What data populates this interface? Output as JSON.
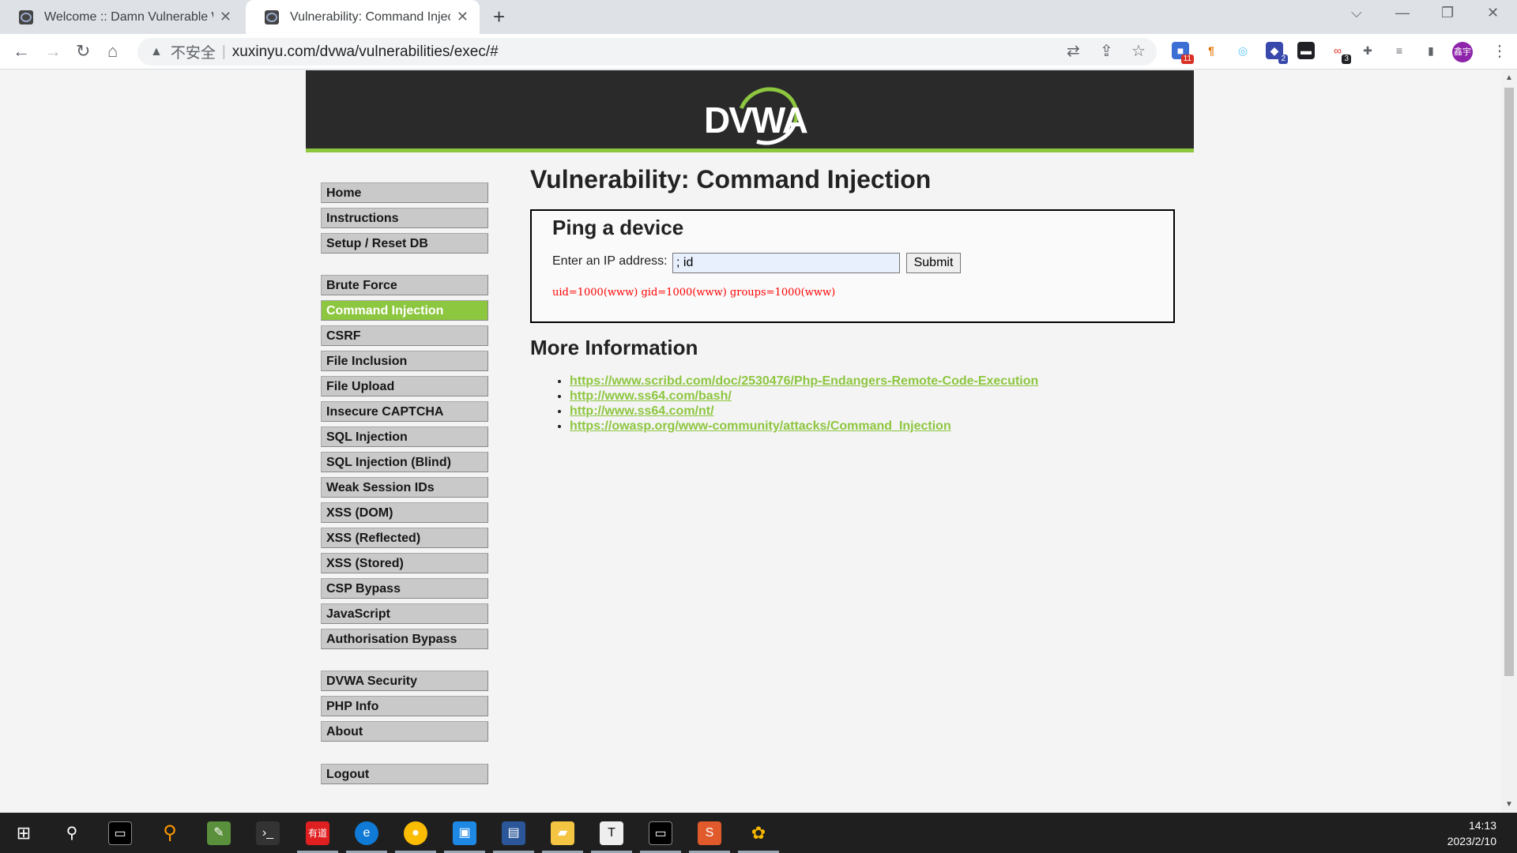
{
  "browser": {
    "tabs": [
      {
        "title": "Welcome :: Damn Vulnerable Web",
        "active": false
      },
      {
        "title": "Vulnerability: Command Inject",
        "active": true
      }
    ],
    "security_label": "不安全",
    "url": "xuxinyu.com/dvwa/vulnerabilities/exec/#",
    "profile_initials": "鑫宇",
    "extension_badges": [
      "11",
      "2",
      "3"
    ]
  },
  "page": {
    "logo_text": "DVWA",
    "menu": {
      "group1": [
        "Home",
        "Instructions",
        "Setup / Reset DB"
      ],
      "group2": [
        "Brute Force",
        "Command Injection",
        "CSRF",
        "File Inclusion",
        "File Upload",
        "Insecure CAPTCHA",
        "SQL Injection",
        "SQL Injection (Blind)",
        "Weak Session IDs",
        "XSS (DOM)",
        "XSS (Reflected)",
        "XSS (Stored)",
        "CSP Bypass",
        "JavaScript",
        "Authorisation Bypass"
      ],
      "group3": [
        "DVWA Security",
        "PHP Info",
        "About"
      ],
      "group4": [
        "Logout"
      ],
      "selected": "Command Injection"
    },
    "title": "Vulnerability: Command Injection",
    "form": {
      "heading": "Ping a device",
      "ip_label": "Enter an IP address:",
      "ip_value": "; id",
      "submit_label": "Submit",
      "output": "uid=1000(www) gid=1000(www) groups=1000(www)"
    },
    "more_info": {
      "heading": "More Information",
      "links": [
        "https://www.scribd.com/doc/2530476/Php-Endangers-Remote-Code-Execution",
        "http://www.ss64.com/bash/",
        "http://www.ss64.com/nt/",
        "https://owasp.org/www-community/attacks/Command_Injection"
      ]
    }
  },
  "taskbar": {
    "time": "14:13",
    "date": "2023/2/10"
  },
  "colors": {
    "accent": "#8dc63f",
    "header": "#2a2a2a",
    "output": "#ff0000"
  }
}
